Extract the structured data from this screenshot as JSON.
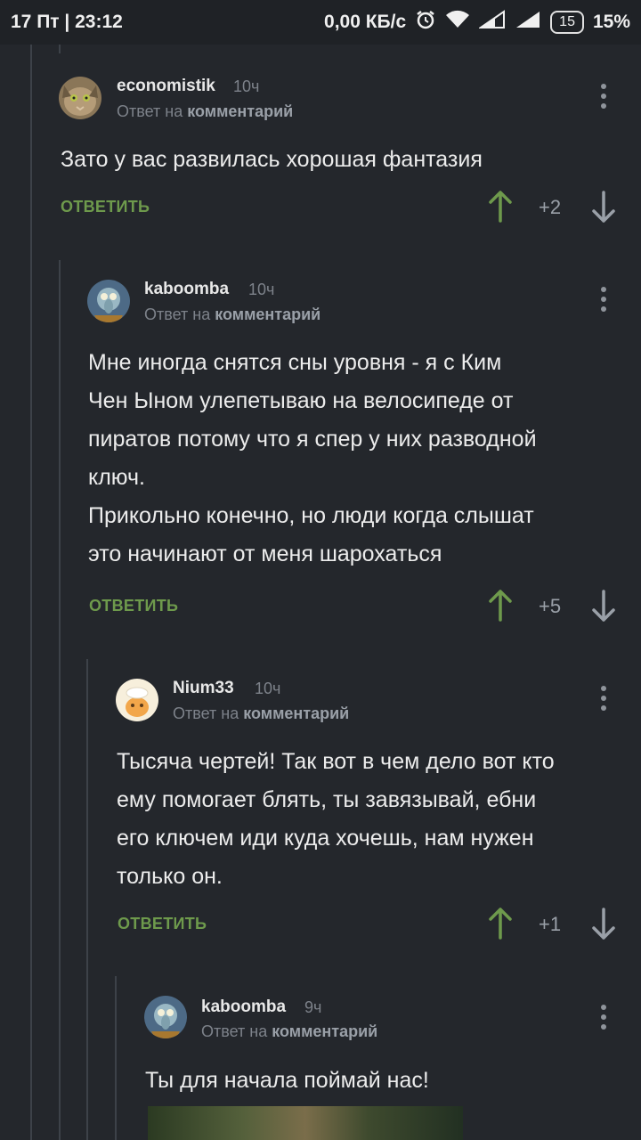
{
  "status_bar": {
    "left": "17 Пт | 23:12",
    "speed": "0,00 КБ/с",
    "battery_level": "15",
    "battery_percent": "15%"
  },
  "comments": [
    {
      "author": "economistik",
      "time": "10ч",
      "reply_prefix": "Ответ на",
      "reply_target": "комментарий",
      "text": "Зато у вас развилась хорошая фантазия",
      "reply_label": "ОТВЕТИТЬ",
      "score": "+2"
    },
    {
      "author": "kaboomba",
      "time": "10ч",
      "reply_prefix": "Ответ на",
      "reply_target": "комментарий",
      "text": "Мне иногда снятся сны уровня - я с Ким\nЧен Ыном улепетываю на велосипеде от\nпиратов потому что я спер у них разводной\nключ.\nПрикольно конечно, но люди когда слышат\nэто начинают от меня шарохаться",
      "reply_label": "ОТВЕТИТЬ",
      "score": "+5"
    },
    {
      "author": "Nium33",
      "time": "10ч",
      "reply_prefix": "Ответ на",
      "reply_target": "комментарий",
      "text": "Тысяча чертей! Так вот в чем дело вот кто\nему помогает блять, ты завязывай, ебни\nего ключем иди куда хочешь, нам нужен\nтолько он.",
      "reply_label": "ОТВЕТИТЬ",
      "score": "+1"
    },
    {
      "author": "kaboomba",
      "time": "9ч",
      "reply_prefix": "Ответ на",
      "reply_target": "комментарий",
      "text": "Ты для начала поймай нас!"
    }
  ]
}
